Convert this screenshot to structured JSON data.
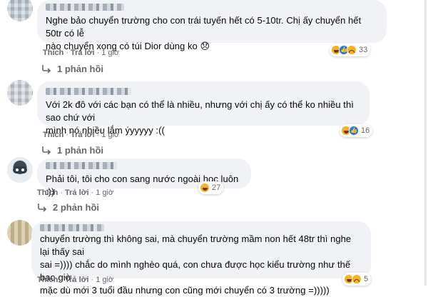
{
  "comments": [
    {
      "text": "Nghe bảo chuyển trường cho con trái tuyến hết có 5-10tr. Chị ấy chuyển hết 50tr có lễ\nnào chuyển xong có túi Dior dùng ko 😞",
      "like_label": "Thích",
      "reply_label": "Trả lời",
      "time": "1 giờ",
      "reactions": [
        "haha-icon",
        "like-icon",
        "sad-icon"
      ],
      "reaction_count": "33",
      "replies_label": "1 phản hồi"
    },
    {
      "text": "Với 2k đô với các bạn có thể là nhiều, nhưng với chị ấy có thể ko nhiều thì sao chứ với\nmình nó nhiều lắm ýyyyyy :((",
      "like_label": "Thích",
      "reply_label": "Trả lời",
      "time": "1 giờ",
      "reactions": [
        "haha-icon",
        "like-icon"
      ],
      "reaction_count": "16",
      "replies_label": "1 phản hồi"
    },
    {
      "text": "Phải tôi, tôi cho con sang nước ngoài học luôn :))",
      "like_label": "Thích",
      "reply_label": "Trả lời",
      "time": "1 giờ",
      "reactions": [
        "haha-icon"
      ],
      "reaction_count": "27",
      "replies_label": "2 phản hồi"
    },
    {
      "text": "chuyển trường thì không sai, mà chuyển trường mầm non hết 48tr thì nghe lại thấy sai\nsai =)))) chắc do mình nghèo quá, con chưa được học kiểu trường như thế bao giờ,\nmặc dù mới 3 tuổi đầu nhưng con cũng mới chuyển có 3 trường =)))))",
      "like_label": "Thích",
      "reply_label": "Trả lời",
      "time": "1 giờ",
      "reactions": [
        "haha-icon",
        "sad-icon"
      ],
      "reaction_count": "5"
    }
  ],
  "colors": {
    "bubble": "#f0f2f5",
    "meta": "#65676b",
    "like_blue": "#1877f2",
    "haha_yellow": "#f7b125"
  }
}
